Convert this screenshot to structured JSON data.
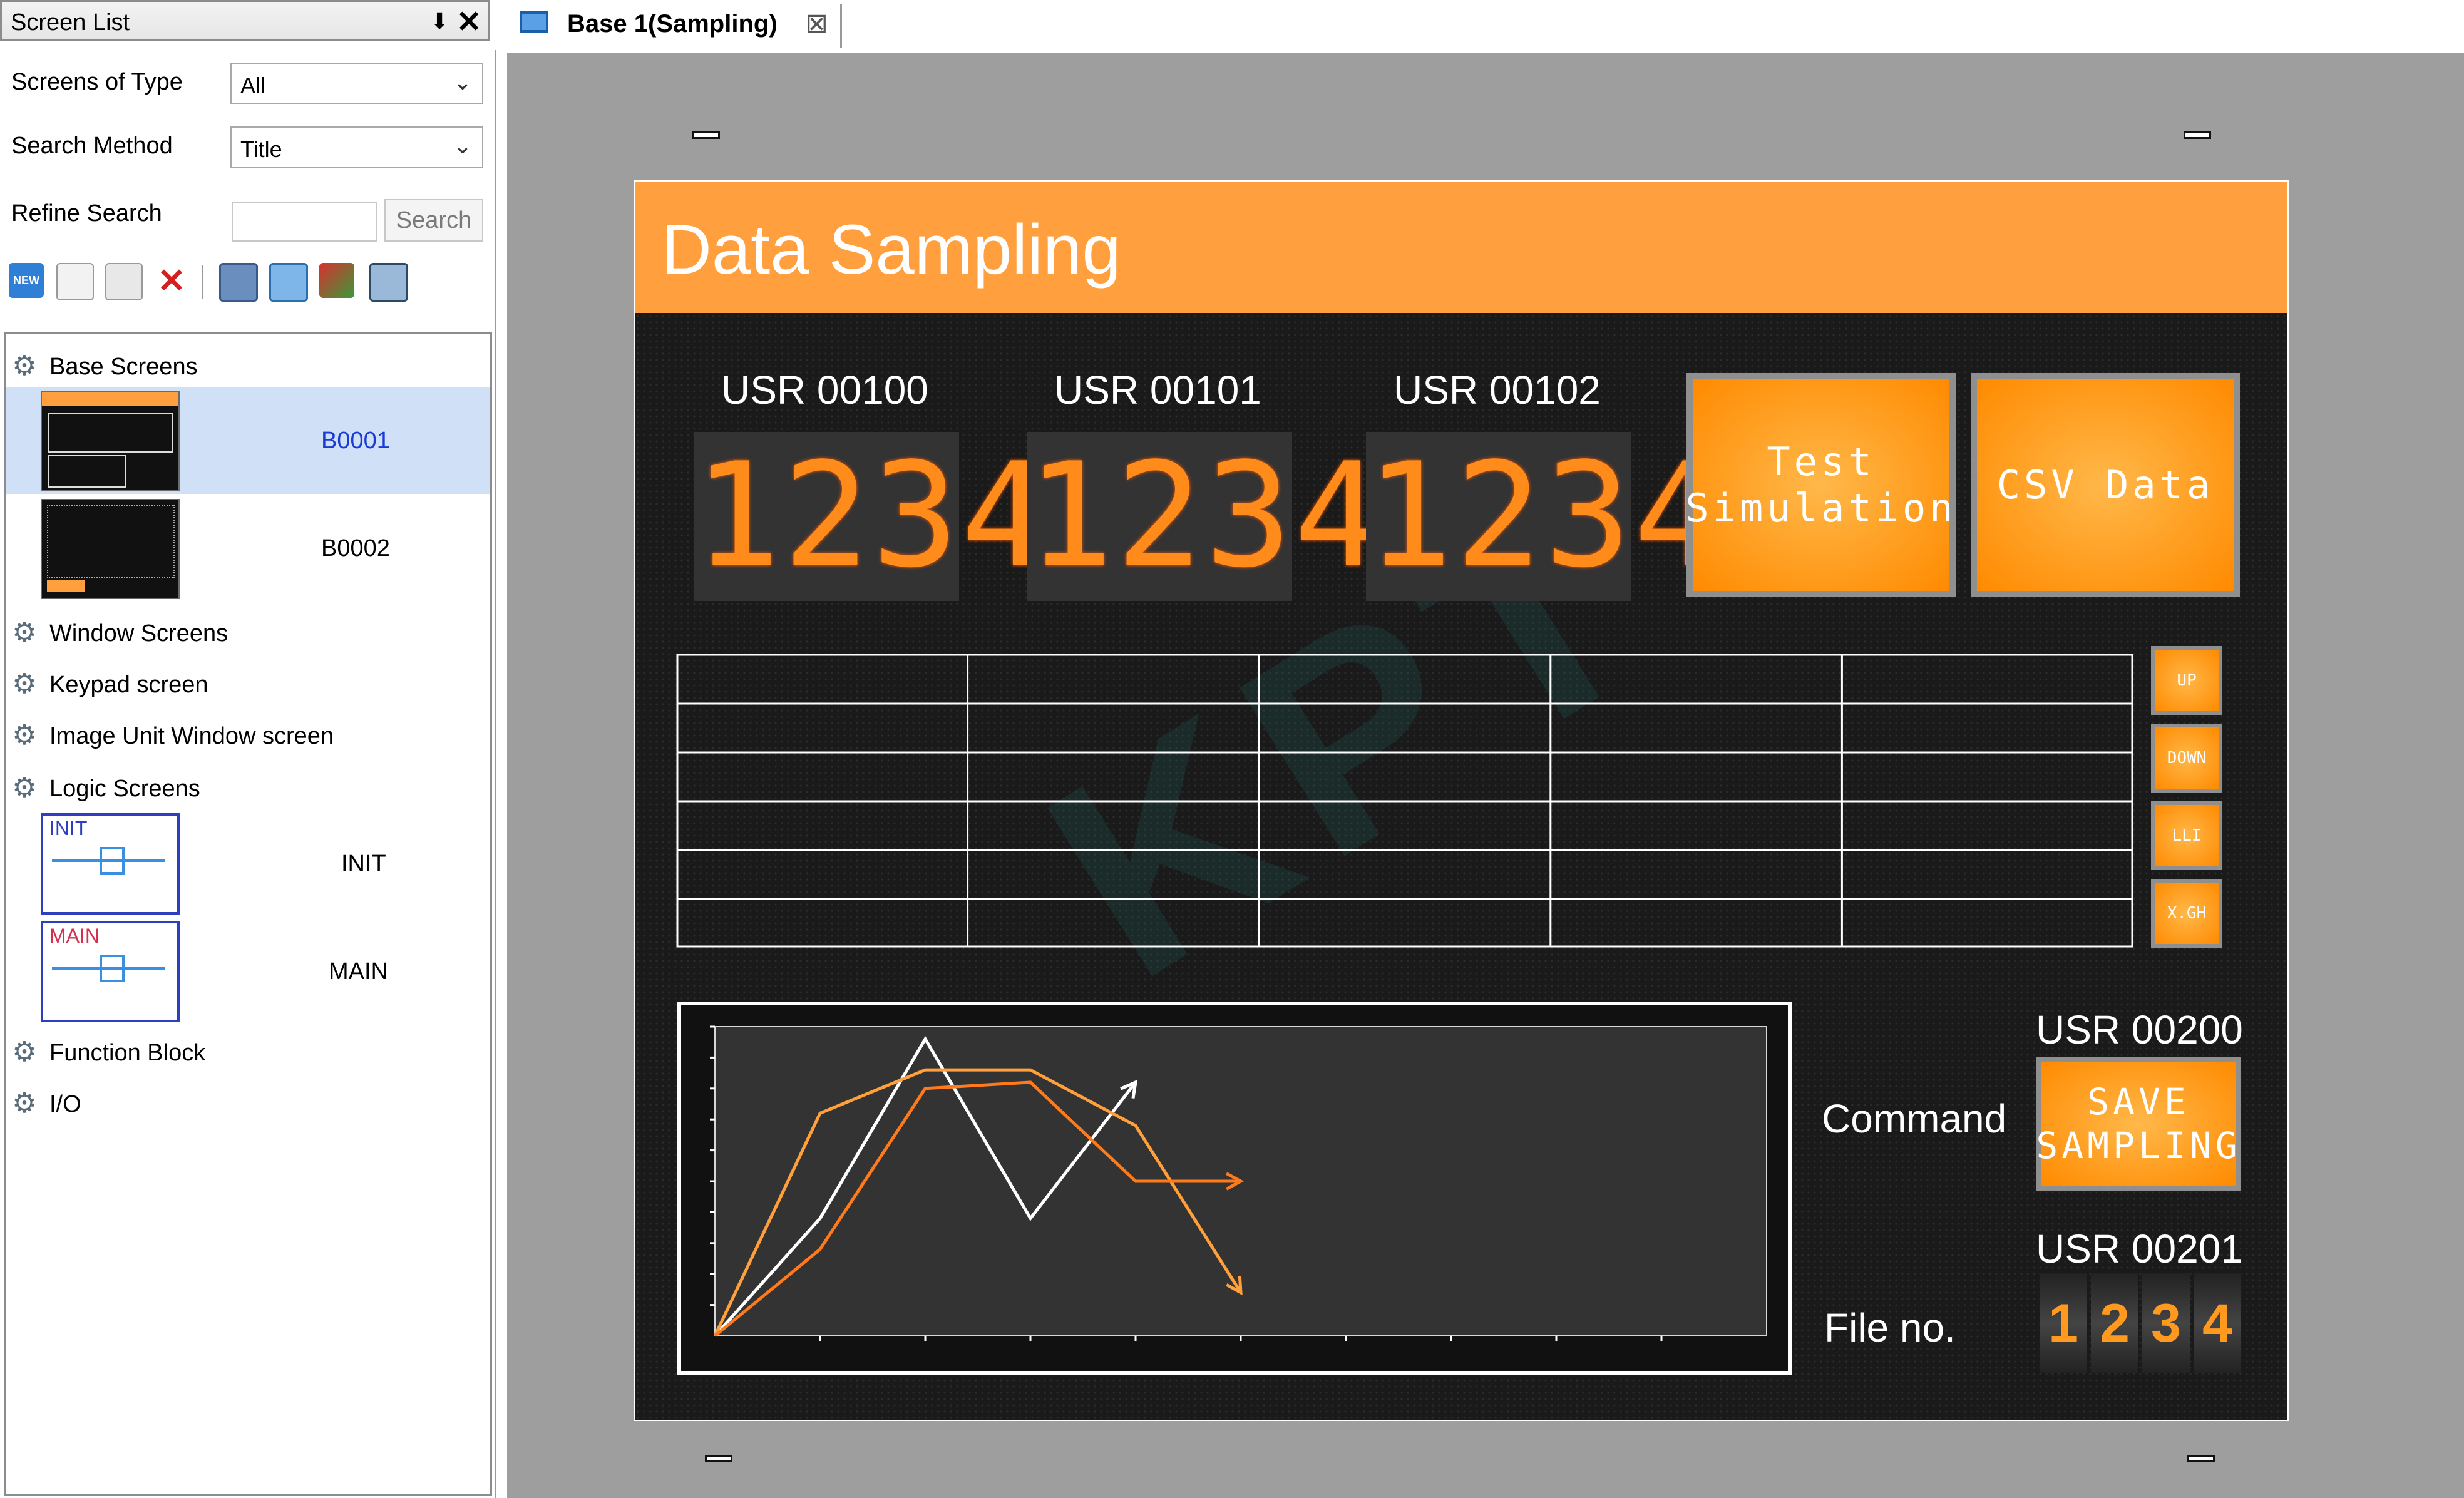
{
  "left_panel": {
    "title": "Screen List",
    "pin_glyph": "⬇",
    "close_glyph": "✕",
    "screens_of_type_label": "Screens of Type",
    "screens_of_type_value": "All",
    "search_method_label": "Search Method",
    "search_method_value": "Title",
    "refine_search_label": "Refine Search",
    "refine_search_value": "",
    "search_button": "Search",
    "toolbar_icons": [
      "new-screen-icon",
      "copy-icon",
      "paste-icon",
      "delete-icon",
      "screen-properties-icon",
      "window-screens-icon",
      "cross-reference-icon",
      "screen-import-icon"
    ],
    "tree": {
      "base_screens": "Base Screens",
      "base_items": [
        {
          "label": "B0001"
        },
        {
          "label": "B0002"
        }
      ],
      "window_screens": "Window Screens",
      "keypad_screen": "Keypad screen",
      "image_unit_window_screen": "Image Unit Window screen",
      "logic_screens": "Logic Screens",
      "logic_items": [
        {
          "label": "INIT",
          "tag": "INIT"
        },
        {
          "label": "MAIN",
          "tag": "MAIN"
        }
      ],
      "function_block": "Function Block",
      "io": "I/O"
    }
  },
  "editor": {
    "tab_title": "Base 1(Sampling)",
    "tab_close": "⊠"
  },
  "hmi": {
    "title": "Data Sampling",
    "displays": [
      {
        "label": "USR 00100",
        "value": "1234"
      },
      {
        "label": "USR 00101",
        "value": "1234"
      },
      {
        "label": "USR 00102",
        "value": "1234"
      }
    ],
    "test_button_line1": "Test",
    "test_button_line2": "Simulation",
    "csv_button": "CSV Data",
    "table_rows": 6,
    "table_cols": 5,
    "side_buttons": [
      "UP",
      "DOWN",
      "LLI",
      "X.GH"
    ],
    "command_label": "Command",
    "save_usr_label": "USR 00200",
    "save_line1": "SAVE",
    "save_line2": "SAMPLING",
    "file_label": "File no.",
    "file_usr_label": "USR 00201",
    "file_digits": [
      "1",
      "2",
      "3",
      "4"
    ],
    "watermark": "KPT"
  },
  "colors": {
    "accent": "#ff9f3d",
    "hmi_background": "#1a1a1a",
    "segment": "#ff8c1a",
    "canvas": "#9e9e9e",
    "selection": "#cfe0f7"
  },
  "chart_data": {
    "type": "line",
    "x": [
      0,
      1,
      2,
      3,
      4,
      5
    ],
    "series": [
      {
        "values": [
          0,
          38,
          96,
          38,
          82
        ]
      },
      {
        "values": [
          0,
          72,
          86,
          86,
          68,
          14
        ]
      },
      {
        "values": [
          0,
          28,
          80,
          82,
          50,
          50
        ]
      }
    ],
    "ylim": [
      0,
      100
    ],
    "xlim": [
      0,
      10
    ],
    "grid": false
  }
}
